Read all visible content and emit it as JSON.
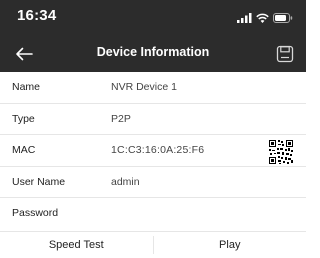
{
  "status_bar": {
    "time": "16:34",
    "signal_icon": "cellular-signal-icon",
    "wifi_icon": "wifi-icon",
    "battery_icon": "battery-icon"
  },
  "nav": {
    "title": "Device Information",
    "back_icon": "back-arrow-icon",
    "save_icon": "save-icon"
  },
  "fields": {
    "name": {
      "label": "Name",
      "value": "NVR Device 1"
    },
    "type": {
      "label": "Type",
      "value": "P2P"
    },
    "mac": {
      "label": "MAC",
      "value": "1C:C3:16:0A:25:F6",
      "qr_icon": "qr-code-icon"
    },
    "username": {
      "label": "User Name",
      "value": "admin"
    },
    "password": {
      "label": "Password",
      "value": ""
    }
  },
  "actions": {
    "speed_test": "Speed Test",
    "play": "Play"
  },
  "colors": {
    "header_bg": "#2c2c2c",
    "header_text": "#ffffff",
    "divider": "#e6e6e6",
    "label_text": "#222222",
    "value_text": "#444444"
  }
}
